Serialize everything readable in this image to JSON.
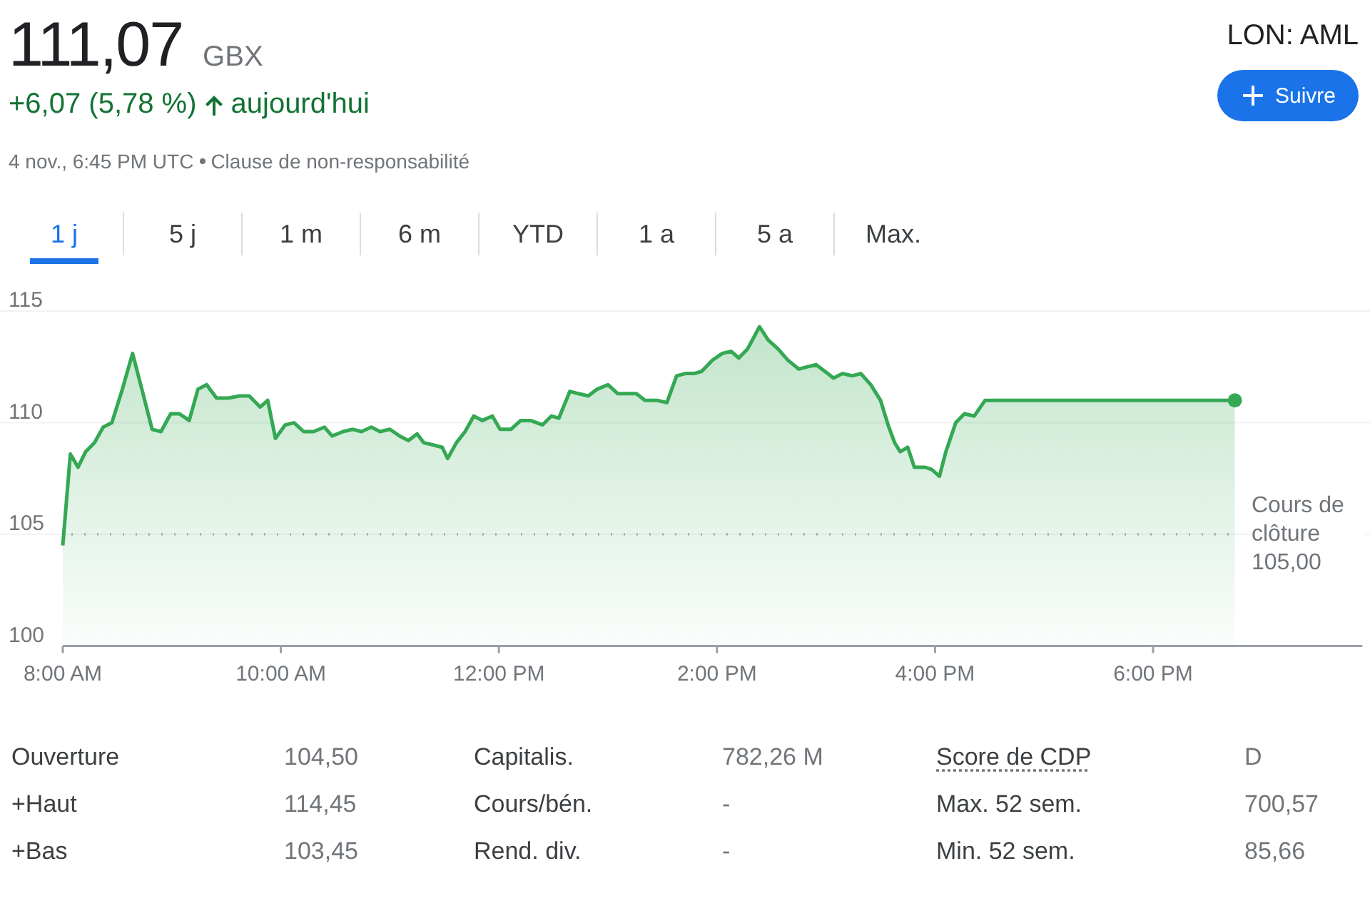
{
  "quote": {
    "price": "111,07",
    "currency": "GBX",
    "change": "+6,07 (5,78 %)",
    "period": "aujourd'hui",
    "timestamp": "4 nov., 6:45 PM UTC",
    "disclaimer": "Clause de non-responsabilité",
    "ticker": "LON: AML",
    "follow_button": "Suivre"
  },
  "tabs": [
    {
      "label": "1 j",
      "selected": true
    },
    {
      "label": "5 j",
      "selected": false
    },
    {
      "label": "1 m",
      "selected": false
    },
    {
      "label": "6 m",
      "selected": false
    },
    {
      "label": "YTD",
      "selected": false
    },
    {
      "label": "1 a",
      "selected": false
    },
    {
      "label": "5 a",
      "selected": false
    },
    {
      "label": "Max.",
      "selected": false
    }
  ],
  "chart": {
    "chart_data": {
      "type": "area",
      "xlim": [
        8,
        19.92
      ],
      "ylim": [
        100,
        115
      ],
      "yticks": [
        100,
        105,
        110,
        115
      ],
      "xticks": [
        {
          "value": 8,
          "label": "8:00 AM"
        },
        {
          "value": 10,
          "label": "10:00 AM"
        },
        {
          "value": 12,
          "label": "12:00 PM"
        },
        {
          "value": 14,
          "label": "2:00 PM"
        },
        {
          "value": 16,
          "label": "4:00 PM"
        },
        {
          "value": 18,
          "label": "6:00 PM"
        }
      ],
      "x": [
        8.0,
        8.07,
        8.14,
        8.21,
        8.29,
        8.37,
        8.45,
        8.54,
        8.64,
        8.73,
        8.82,
        8.9,
        8.99,
        9.07,
        9.16,
        9.24,
        9.32,
        9.41,
        9.52,
        9.62,
        9.71,
        9.81,
        9.88,
        9.95,
        10.04,
        10.12,
        10.21,
        10.3,
        10.4,
        10.47,
        10.57,
        10.66,
        10.74,
        10.83,
        10.91,
        11.0,
        11.09,
        11.17,
        11.25,
        11.31,
        11.4,
        11.48,
        11.53,
        11.61,
        11.69,
        11.77,
        11.85,
        11.94,
        12.01,
        12.11,
        12.2,
        12.29,
        12.4,
        12.48,
        12.55,
        12.65,
        12.73,
        12.82,
        12.9,
        13.0,
        13.09,
        13.18,
        13.26,
        13.34,
        13.45,
        13.54,
        13.63,
        13.71,
        13.79,
        13.86,
        13.96,
        14.05,
        14.13,
        14.2,
        14.28,
        14.39,
        14.47,
        14.56,
        14.65,
        14.75,
        14.83,
        14.91,
        14.99,
        15.07,
        15.15,
        15.24,
        15.32,
        15.41,
        15.5,
        15.57,
        15.63,
        15.68,
        15.75,
        15.81,
        15.91,
        15.97,
        16.04,
        16.1,
        16.19,
        16.27,
        16.36,
        16.46,
        18.75
      ],
      "series": [
        {
          "color": "#34a853",
          "values": [
            104.5,
            108.6,
            108.0,
            108.7,
            109.1,
            109.8,
            110.0,
            111.4,
            113.1,
            111.4,
            109.7,
            109.6,
            110.4,
            110.4,
            110.1,
            111.5,
            111.7,
            111.1,
            111.1,
            111.2,
            111.2,
            110.7,
            111.0,
            109.3,
            109.9,
            110.0,
            109.6,
            109.6,
            109.8,
            109.4,
            109.6,
            109.7,
            109.6,
            109.8,
            109.6,
            109.7,
            109.4,
            109.2,
            109.5,
            109.1,
            109.0,
            108.9,
            108.4,
            109.1,
            109.6,
            110.3,
            110.1,
            110.3,
            109.7,
            109.7,
            110.1,
            110.1,
            109.9,
            110.3,
            110.2,
            111.4,
            111.3,
            111.2,
            111.5,
            111.7,
            111.3,
            111.3,
            111.3,
            111.0,
            111.0,
            110.9,
            112.1,
            112.2,
            112.2,
            112.3,
            112.8,
            113.1,
            113.2,
            112.9,
            113.3,
            114.3,
            113.7,
            113.3,
            112.8,
            112.4,
            112.5,
            112.6,
            112.3,
            112.0,
            112.2,
            112.1,
            112.2,
            111.7,
            111.0,
            109.9,
            109.1,
            108.7,
            108.9,
            108.0,
            108.0,
            107.9,
            107.6,
            108.7,
            110.0,
            110.4,
            110.3,
            111.0,
            111.0
          ]
        }
      ],
      "ref_lines": [
        {
          "axis": "y",
          "value": 105
        }
      ],
      "annotations": [
        "Cours de clôture 105,00"
      ]
    }
  },
  "stats": [
    {
      "label": "Ouverture",
      "value": "104,50",
      "underlined": false
    },
    {
      "label": "Capitalis.",
      "value": "782,26 M",
      "underlined": false
    },
    {
      "label": "Score de CDP",
      "value": "D",
      "underlined": true
    },
    {
      "label": "+Haut",
      "value": "114,45",
      "underlined": false
    },
    {
      "label": "Cours/bén.",
      "value": "-",
      "underlined": false
    },
    {
      "label": "Max. 52 sem.",
      "value": "700,57",
      "underlined": false
    },
    {
      "label": "+Bas",
      "value": "103,45",
      "underlined": false
    },
    {
      "label": "Rend. div.",
      "value": "-",
      "underlined": false
    },
    {
      "label": "Min. 52 sem.",
      "value": "85,66",
      "underlined": false
    }
  ]
}
